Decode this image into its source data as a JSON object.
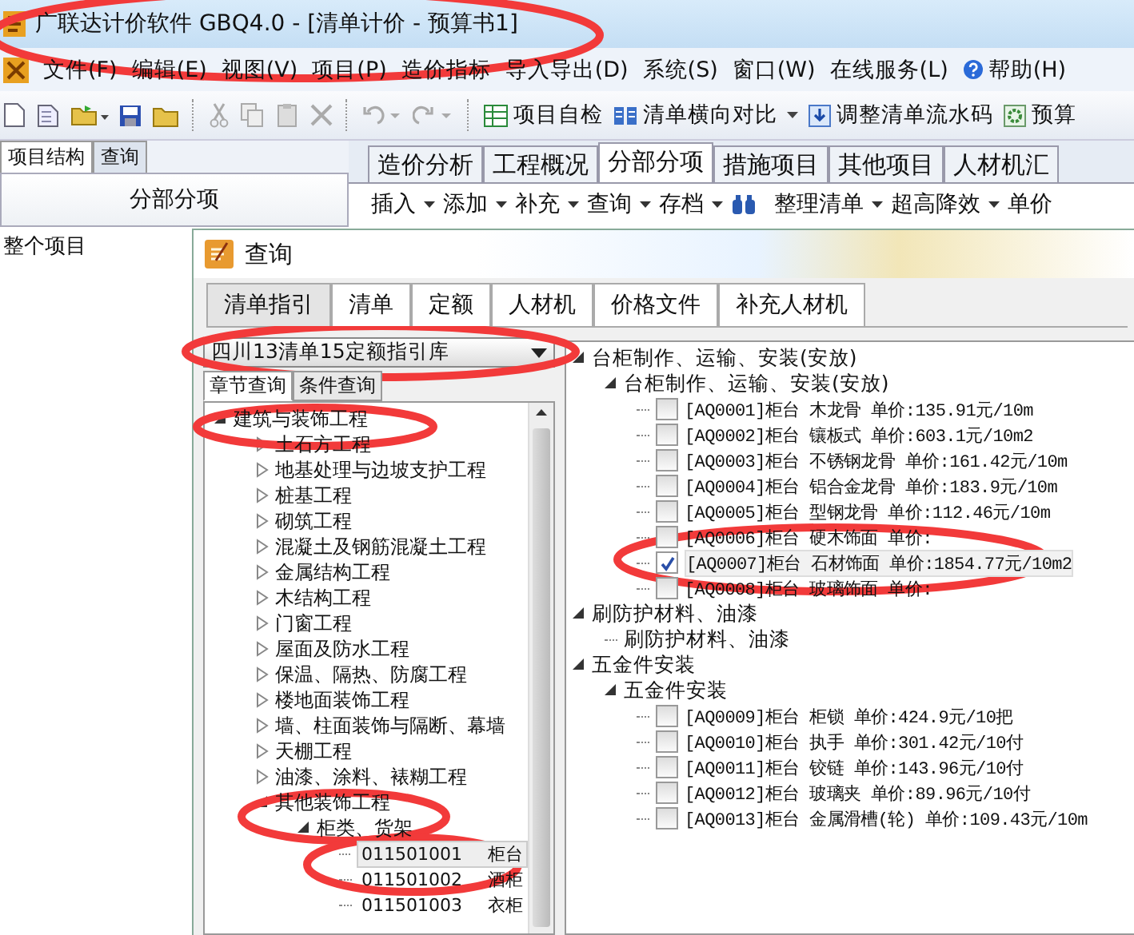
{
  "window": {
    "title": "广联达计价软件 GBQ4.0 - [清单计价 - 预算书1]"
  },
  "menu": [
    "文件(F)",
    "编辑(E)",
    "视图(V)",
    "项目(P)",
    "造价指标",
    "导入导出(D)",
    "系统(S)",
    "窗口(W)",
    "在线服务(L)",
    "帮助(H)"
  ],
  "toolbar": [
    {
      "label": "项目自检",
      "dropdown": false
    },
    {
      "label": "清单横向对比",
      "dropdown": true
    },
    {
      "label": "调整清单流水码",
      "dropdown": false
    },
    {
      "label": "预算",
      "dropdown": false
    }
  ],
  "left_panel": {
    "tabs": [
      {
        "label": "项目结构",
        "selected": true
      },
      {
        "label": "查询",
        "selected": false
      }
    ],
    "header": "分部分项",
    "items": [
      "整个项目"
    ]
  },
  "main_tabs": [
    {
      "label": "造价分析",
      "selected": false
    },
    {
      "label": "工程概况",
      "selected": false
    },
    {
      "label": "分部分项",
      "selected": true
    },
    {
      "label": "措施项目",
      "selected": false
    },
    {
      "label": "其他项目",
      "selected": false
    },
    {
      "label": "人材机汇",
      "selected": false
    }
  ],
  "main_toolbar": [
    {
      "kind": "menu",
      "label": "插入"
    },
    {
      "kind": "menu",
      "label": "添加"
    },
    {
      "kind": "menu",
      "label": "补充"
    },
    {
      "kind": "menu",
      "label": "查询"
    },
    {
      "kind": "menu",
      "label": "存档"
    },
    {
      "kind": "find"
    },
    {
      "kind": "menu",
      "label": "整理清单"
    },
    {
      "kind": "menu",
      "label": "超高降效"
    },
    {
      "kind": "text",
      "label": "单价"
    }
  ],
  "dialog": {
    "title": "查询",
    "tabs": [
      {
        "label": "清单指引",
        "selected": true
      },
      {
        "label": "清单",
        "selected": false
      },
      {
        "label": "定额",
        "selected": false
      },
      {
        "label": "人材机",
        "selected": false
      },
      {
        "label": "价格文件",
        "selected": false
      },
      {
        "label": "补充人材机",
        "selected": false
      }
    ],
    "library": "四川13清单15定额指引库",
    "subtabs": [
      {
        "label": "章节查询",
        "selected": true
      },
      {
        "label": "条件查询",
        "selected": false
      }
    ],
    "tree": [
      {
        "label": "建筑与装饰工程",
        "expanded": true,
        "children": [
          {
            "label": "土石方工程",
            "expanded": false
          },
          {
            "label": "地基处理与边坡支护工程",
            "expanded": false
          },
          {
            "label": "桩基工程",
            "expanded": false
          },
          {
            "label": "砌筑工程",
            "expanded": false
          },
          {
            "label": "混凝土及钢筋混凝土工程",
            "expanded": false
          },
          {
            "label": "金属结构工程",
            "expanded": false
          },
          {
            "label": "木结构工程",
            "expanded": false
          },
          {
            "label": "门窗工程",
            "expanded": false
          },
          {
            "label": "屋面及防水工程",
            "expanded": false
          },
          {
            "label": "保温、隔热、防腐工程",
            "expanded": false
          },
          {
            "label": "楼地面装饰工程",
            "expanded": false
          },
          {
            "label": "墙、柱面装饰与隔断、幕墙",
            "expanded": false
          },
          {
            "label": "天棚工程",
            "expanded": false
          },
          {
            "label": "油漆、涂料、裱糊工程",
            "expanded": false
          },
          {
            "label": "其他装饰工程",
            "expanded": true,
            "children": [
              {
                "label": "柜类、货架",
                "expanded": true,
                "children": [
                  {
                    "code": "011501001",
                    "label": "柜台",
                    "selected": true
                  },
                  {
                    "code": "011501002",
                    "label": "酒柜",
                    "selected": false
                  },
                  {
                    "code": "011501003",
                    "label": "衣柜",
                    "selected": false
                  }
                ]
              }
            ]
          }
        ]
      }
    ],
    "results": [
      {
        "label": "台柜制作、运输、安装(安放)",
        "expanded": true,
        "children": [
          {
            "label": "台柜制作、运输、安装(安放)",
            "expanded": true,
            "children": [
              {
                "label": "[AQ0001]柜台 木龙骨 单价:135.91元/10m",
                "checked": false,
                "selected": false
              },
              {
                "label": "[AQ0002]柜台 镶板式 单价:603.1元/10m2",
                "checked": false,
                "selected": false
              },
              {
                "label": "[AQ0003]柜台 不锈钢龙骨 单价:161.42元/10m",
                "checked": false,
                "selected": false
              },
              {
                "label": "[AQ0004]柜台 铝合金龙骨 单价:183.9元/10m",
                "checked": false,
                "selected": false
              },
              {
                "label": "[AQ0005]柜台 型钢龙骨 单价:112.46元/10m",
                "checked": false,
                "selected": false
              },
              {
                "label": "[AQ0006]柜台 硬木饰面 单价:",
                "checked": false,
                "selected": false
              },
              {
                "label": "[AQ0007]柜台 石材饰面 单价:1854.77元/10m2",
                "checked": true,
                "selected": true
              },
              {
                "label": "[AQ0008]柜台 玻璃饰面 单价:",
                "checked": false,
                "selected": false
              }
            ]
          }
        ]
      },
      {
        "label": "刷防护材料、油漆",
        "expanded": true,
        "children": [
          {
            "label": "刷防护材料、油漆"
          }
        ]
      },
      {
        "label": "五金件安装",
        "expanded": true,
        "children": [
          {
            "label": "五金件安装",
            "expanded": true,
            "children": [
              {
                "label": "[AQ0009]柜台 柜锁 单价:424.9元/10把",
                "checked": false,
                "selected": false
              },
              {
                "label": "[AQ0010]柜台 执手 单价:301.42元/10付",
                "checked": false,
                "selected": false
              },
              {
                "label": "[AQ0011]柜台 铰链 单价:143.96元/10付",
                "checked": false,
                "selected": false
              },
              {
                "label": "[AQ0012]柜台 玻璃夹 单价:89.96元/10付",
                "checked": false,
                "selected": false
              },
              {
                "label": "[AQ0013]柜台 金属滑槽(轮) 单价:109.43元/10m",
                "checked": false,
                "selected": false
              }
            ]
          }
        ]
      }
    ]
  }
}
